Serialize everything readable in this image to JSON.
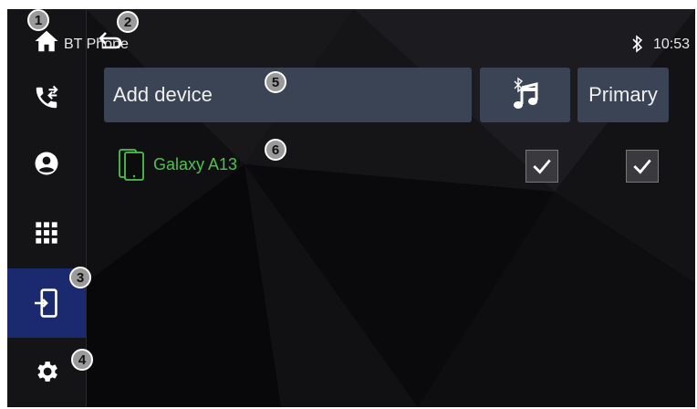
{
  "header": {
    "title": "BT Phone",
    "time": "10:53"
  },
  "sidebar": {
    "items": [
      {
        "name": "home",
        "icon": "home-icon",
        "active": false
      },
      {
        "name": "recent-calls",
        "icon": "phone-transfer-icon",
        "active": false
      },
      {
        "name": "contacts",
        "icon": "contact-icon",
        "active": false
      },
      {
        "name": "dialpad",
        "icon": "grid-icon",
        "active": false
      },
      {
        "name": "devices",
        "icon": "device-connect-icon",
        "active": true
      },
      {
        "name": "settings",
        "icon": "gear-icon",
        "active": false
      }
    ]
  },
  "actions": {
    "add_device_label": "Add device",
    "primary_label": "Primary",
    "music_icon": "bt-music-icon"
  },
  "devices": [
    {
      "name": "Galaxy A13",
      "music_checked": true,
      "primary_checked": true
    }
  ],
  "badges": [
    "1",
    "2",
    "3",
    "4",
    "5",
    "6"
  ],
  "colors": {
    "active": "#1b2a6e",
    "device_name": "#4cc24c",
    "button_bg": "#3a4455"
  }
}
